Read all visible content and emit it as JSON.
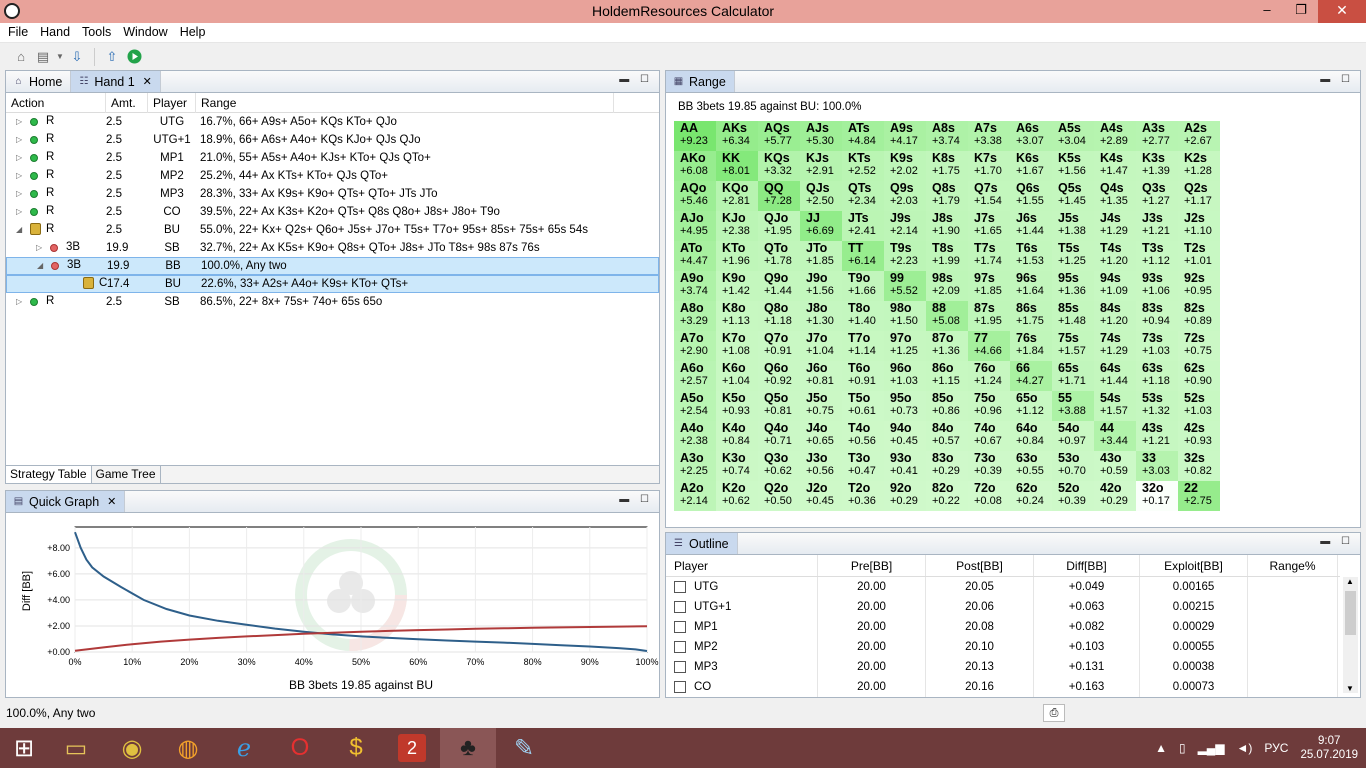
{
  "window": {
    "title": "HoldemResources Calculator",
    "min": "–",
    "max": "❐",
    "close": "✕"
  },
  "menu": [
    "File",
    "Hand",
    "Tools",
    "Window",
    "Help"
  ],
  "tabs": {
    "home": "Home",
    "hand": "Hand 1",
    "range": "Range",
    "quick_graph": "Quick Graph",
    "outline": "Outline"
  },
  "strategy": {
    "headers": {
      "action": "Action",
      "amt": "Amt.",
      "player": "Player",
      "range": "Range"
    },
    "rows": [
      {
        "act": "R",
        "amt": "2.5",
        "player": "UTG",
        "range": "16.7%, 66+ A9s+ A5o+ KQs KTo+ QJo",
        "dot": "g"
      },
      {
        "act": "R",
        "amt": "2.5",
        "player": "UTG+1",
        "range": "18.9%, 66+ A6s+ A4o+ KQs KJo+ QJs QJo",
        "dot": "g"
      },
      {
        "act": "R",
        "amt": "2.5",
        "player": "MP1",
        "range": "21.0%, 55+ A5s+ A4o+ KJs+ KTo+ QJs QTo+",
        "dot": "g"
      },
      {
        "act": "R",
        "amt": "2.5",
        "player": "MP2",
        "range": "25.2%, 44+ Ax KTs+ KTo+ QJs QTo+",
        "dot": "g"
      },
      {
        "act": "R",
        "amt": "2.5",
        "player": "MP3",
        "range": "28.3%, 33+ Ax K9s+ K9o+ QTs+ QTo+ JTs JTo",
        "dot": "g"
      },
      {
        "act": "R",
        "amt": "2.5",
        "player": "CO",
        "range": "39.5%, 22+ Ax K3s+ K2o+ QTs+ Q8s Q8o+ J8s+ J8o+ T9o",
        "dot": "g"
      },
      {
        "act": "R",
        "amt": "2.5",
        "player": "BU",
        "range": "55.0%, 22+ Kx+ Q2s+ Q6o+ J5s+ J7o+ T5s+ T7o+ 95s+ 85s+ 75s+ 65s 54s",
        "dot": "lock"
      },
      {
        "act": "3B",
        "amt": "19.9",
        "player": "SB",
        "range": "32.7%, 22+ Ax K5s+ K9o+ Q8s+ QTo+ J8s+ JTo T8s+ 98s 87s 76s",
        "dot": "r"
      },
      {
        "act": "3B",
        "amt": "19.9",
        "player": "BB",
        "range": "100.0%, Any two",
        "dot": "r"
      },
      {
        "act": "C",
        "amt": "17.4",
        "player": "BU",
        "range": "22.6%, 33+ A2s+ A4o+ K9s+ KTo+ QTs+",
        "dot": "lock"
      },
      {
        "act": "R",
        "amt": "2.5",
        "player": "SB",
        "range": "86.5%, 22+ 8x+ 75s+ 74o+ 65s 65o",
        "dot": "g"
      }
    ],
    "bottom_tabs": [
      "Strategy Table",
      "Game Tree"
    ]
  },
  "range": {
    "caption": "BB 3bets 19.85 against BU: 100.0%",
    "hands": [
      [
        "AA",
        "+9.23"
      ],
      [
        "AKs",
        "+6.34"
      ],
      [
        "AQs",
        "+5.77"
      ],
      [
        "AJs",
        "+5.30"
      ],
      [
        "ATs",
        "+4.84"
      ],
      [
        "A9s",
        "+4.17"
      ],
      [
        "A8s",
        "+3.74"
      ],
      [
        "A7s",
        "+3.38"
      ],
      [
        "A6s",
        "+3.07"
      ],
      [
        "A5s",
        "+3.04"
      ],
      [
        "A4s",
        "+2.89"
      ],
      [
        "A3s",
        "+2.77"
      ],
      [
        "A2s",
        "+2.67"
      ],
      [
        "AKo",
        "+6.08"
      ],
      [
        "KK",
        "+8.01"
      ],
      [
        "KQs",
        "+3.32"
      ],
      [
        "KJs",
        "+2.91"
      ],
      [
        "KTs",
        "+2.52"
      ],
      [
        "K9s",
        "+2.02"
      ],
      [
        "K8s",
        "+1.75"
      ],
      [
        "K7s",
        "+1.70"
      ],
      [
        "K6s",
        "+1.67"
      ],
      [
        "K5s",
        "+1.56"
      ],
      [
        "K4s",
        "+1.47"
      ],
      [
        "K3s",
        "+1.39"
      ],
      [
        "K2s",
        "+1.28"
      ],
      [
        "AQo",
        "+5.46"
      ],
      [
        "KQo",
        "+2.81"
      ],
      [
        "QQ",
        "+7.28"
      ],
      [
        "QJs",
        "+2.50"
      ],
      [
        "QTs",
        "+2.34"
      ],
      [
        "Q9s",
        "+2.03"
      ],
      [
        "Q8s",
        "+1.79"
      ],
      [
        "Q7s",
        "+1.54"
      ],
      [
        "Q6s",
        "+1.55"
      ],
      [
        "Q5s",
        "+1.45"
      ],
      [
        "Q4s",
        "+1.35"
      ],
      [
        "Q3s",
        "+1.27"
      ],
      [
        "Q2s",
        "+1.17"
      ],
      [
        "AJo",
        "+4.95"
      ],
      [
        "KJo",
        "+2.38"
      ],
      [
        "QJo",
        "+1.95"
      ],
      [
        "JJ",
        "+6.69"
      ],
      [
        "JTs",
        "+2.41"
      ],
      [
        "J9s",
        "+2.14"
      ],
      [
        "J8s",
        "+1.90"
      ],
      [
        "J7s",
        "+1.65"
      ],
      [
        "J6s",
        "+1.44"
      ],
      [
        "J5s",
        "+1.38"
      ],
      [
        "J4s",
        "+1.29"
      ],
      [
        "J3s",
        "+1.21"
      ],
      [
        "J2s",
        "+1.10"
      ],
      [
        "ATo",
        "+4.47"
      ],
      [
        "KTo",
        "+1.96"
      ],
      [
        "QTo",
        "+1.78"
      ],
      [
        "JTo",
        "+1.85"
      ],
      [
        "TT",
        "+6.14"
      ],
      [
        "T9s",
        "+2.23"
      ],
      [
        "T8s",
        "+1.99"
      ],
      [
        "T7s",
        "+1.74"
      ],
      [
        "T6s",
        "+1.53"
      ],
      [
        "T5s",
        "+1.25"
      ],
      [
        "T4s",
        "+1.20"
      ],
      [
        "T3s",
        "+1.12"
      ],
      [
        "T2s",
        "+1.01"
      ],
      [
        "A9o",
        "+3.74"
      ],
      [
        "K9o",
        "+1.42"
      ],
      [
        "Q9o",
        "+1.44"
      ],
      [
        "J9o",
        "+1.56"
      ],
      [
        "T9o",
        "+1.66"
      ],
      [
        "99",
        "+5.52"
      ],
      [
        "98s",
        "+2.09"
      ],
      [
        "97s",
        "+1.85"
      ],
      [
        "96s",
        "+1.64"
      ],
      [
        "95s",
        "+1.36"
      ],
      [
        "94s",
        "+1.09"
      ],
      [
        "93s",
        "+1.06"
      ],
      [
        "92s",
        "+0.95"
      ],
      [
        "A8o",
        "+3.29"
      ],
      [
        "K8o",
        "+1.13"
      ],
      [
        "Q8o",
        "+1.18"
      ],
      [
        "J8o",
        "+1.30"
      ],
      [
        "T8o",
        "+1.40"
      ],
      [
        "98o",
        "+1.50"
      ],
      [
        "88",
        "+5.08"
      ],
      [
        "87s",
        "+1.95"
      ],
      [
        "86s",
        "+1.75"
      ],
      [
        "85s",
        "+1.48"
      ],
      [
        "84s",
        "+1.20"
      ],
      [
        "83s",
        "+0.94"
      ],
      [
        "82s",
        "+0.89"
      ],
      [
        "A7o",
        "+2.90"
      ],
      [
        "K7o",
        "+1.08"
      ],
      [
        "Q7o",
        "+0.91"
      ],
      [
        "J7o",
        "+1.04"
      ],
      [
        "T7o",
        "+1.14"
      ],
      [
        "97o",
        "+1.25"
      ],
      [
        "87o",
        "+1.36"
      ],
      [
        "77",
        "+4.66"
      ],
      [
        "76s",
        "+1.84"
      ],
      [
        "75s",
        "+1.57"
      ],
      [
        "74s",
        "+1.29"
      ],
      [
        "73s",
        "+1.03"
      ],
      [
        "72s",
        "+0.75"
      ],
      [
        "A6o",
        "+2.57"
      ],
      [
        "K6o",
        "+1.04"
      ],
      [
        "Q6o",
        "+0.92"
      ],
      [
        "J6o",
        "+0.81"
      ],
      [
        "T6o",
        "+0.91"
      ],
      [
        "96o",
        "+1.03"
      ],
      [
        "86o",
        "+1.15"
      ],
      [
        "76o",
        "+1.24"
      ],
      [
        "66",
        "+4.27"
      ],
      [
        "65s",
        "+1.71"
      ],
      [
        "64s",
        "+1.44"
      ],
      [
        "63s",
        "+1.18"
      ],
      [
        "62s",
        "+0.90"
      ],
      [
        "A5o",
        "+2.54"
      ],
      [
        "K5o",
        "+0.93"
      ],
      [
        "Q5o",
        "+0.81"
      ],
      [
        "J5o",
        "+0.75"
      ],
      [
        "T5o",
        "+0.61"
      ],
      [
        "95o",
        "+0.73"
      ],
      [
        "85o",
        "+0.86"
      ],
      [
        "75o",
        "+0.96"
      ],
      [
        "65o",
        "+1.12"
      ],
      [
        "55",
        "+3.88"
      ],
      [
        "54s",
        "+1.57"
      ],
      [
        "53s",
        "+1.32"
      ],
      [
        "52s",
        "+1.03"
      ],
      [
        "A4o",
        "+2.38"
      ],
      [
        "K4o",
        "+0.84"
      ],
      [
        "Q4o",
        "+0.71"
      ],
      [
        "J4o",
        "+0.65"
      ],
      [
        "T4o",
        "+0.56"
      ],
      [
        "94o",
        "+0.45"
      ],
      [
        "84o",
        "+0.57"
      ],
      [
        "74o",
        "+0.67"
      ],
      [
        "64o",
        "+0.84"
      ],
      [
        "54o",
        "+0.97"
      ],
      [
        "44",
        "+3.44"
      ],
      [
        "43s",
        "+1.21"
      ],
      [
        "42s",
        "+0.93"
      ],
      [
        "A3o",
        "+2.25"
      ],
      [
        "K3o",
        "+0.74"
      ],
      [
        "Q3o",
        "+0.62"
      ],
      [
        "J3o",
        "+0.56"
      ],
      [
        "T3o",
        "+0.47"
      ],
      [
        "93o",
        "+0.41"
      ],
      [
        "83o",
        "+0.29"
      ],
      [
        "73o",
        "+0.39"
      ],
      [
        "63o",
        "+0.55"
      ],
      [
        "53o",
        "+0.70"
      ],
      [
        "43o",
        "+0.59"
      ],
      [
        "33",
        "+3.03"
      ],
      [
        "32s",
        "+0.82"
      ],
      [
        "A2o",
        "+2.14"
      ],
      [
        "K2o",
        "+0.62"
      ],
      [
        "Q2o",
        "+0.50"
      ],
      [
        "J2o",
        "+0.45"
      ],
      [
        "T2o",
        "+0.36"
      ],
      [
        "92o",
        "+0.29"
      ],
      [
        "82o",
        "+0.22"
      ],
      [
        "72o",
        "+0.08"
      ],
      [
        "62o",
        "+0.24"
      ],
      [
        "52o",
        "+0.39"
      ],
      [
        "42o",
        "+0.29"
      ],
      [
        "32o",
        "+0.17"
      ],
      [
        "22",
        "+2.75"
      ]
    ]
  },
  "chart_data": {
    "type": "line",
    "title": "",
    "xlabel": "BB 3bets 19.85 against BU",
    "ylabel": "Diff [BB]",
    "x_ticks": [
      "0%",
      "10%",
      "20%",
      "30%",
      "40%",
      "50%",
      "60%",
      "70%",
      "80%",
      "90%",
      "100%"
    ],
    "y_ticks": [
      "+0.00",
      "+2.00",
      "+4.00",
      "+6.00",
      "+8.00"
    ],
    "xlim": [
      0,
      100
    ],
    "ylim": [
      0,
      9.6
    ],
    "series": [
      {
        "color": "#2e5f8a",
        "x": [
          0,
          1,
          2,
          3,
          5,
          8,
          12,
          16,
          20,
          25,
          30,
          35,
          40,
          45,
          50,
          55,
          60,
          65,
          70,
          75,
          80,
          85,
          90,
          95,
          98,
          100
        ],
        "values": [
          9.2,
          8.0,
          7.1,
          6.5,
          5.8,
          5.0,
          4.0,
          3.3,
          2.8,
          2.4,
          2.1,
          1.8,
          1.55,
          1.35,
          1.2,
          1.08,
          0.98,
          0.88,
          0.8,
          0.72,
          0.62,
          0.52,
          0.42,
          0.3,
          0.2,
          0.08
        ]
      },
      {
        "color": "#b03a3a",
        "x": [
          0,
          5,
          10,
          15,
          20,
          25,
          30,
          35,
          40,
          45,
          50,
          55,
          60,
          65,
          70,
          75,
          80,
          85,
          90,
          95,
          100
        ],
        "values": [
          0.1,
          0.35,
          0.6,
          0.8,
          0.95,
          1.08,
          1.2,
          1.3,
          1.4,
          1.48,
          1.55,
          1.62,
          1.68,
          1.73,
          1.78,
          1.82,
          1.86,
          1.89,
          1.92,
          1.95,
          1.98
        ]
      }
    ]
  },
  "outline": {
    "headers": [
      "Player",
      "Pre[BB]",
      "Post[BB]",
      "Diff[BB]",
      "Exploit[BB]",
      "Range%"
    ],
    "rows": [
      [
        "UTG",
        "20.00",
        "20.05",
        "+0.049",
        "0.00165",
        ""
      ],
      [
        "UTG+1",
        "20.00",
        "20.06",
        "+0.063",
        "0.00215",
        ""
      ],
      [
        "MP1",
        "20.00",
        "20.08",
        "+0.082",
        "0.00029",
        ""
      ],
      [
        "MP2",
        "20.00",
        "20.10",
        "+0.103",
        "0.00055",
        ""
      ],
      [
        "MP3",
        "20.00",
        "20.13",
        "+0.131",
        "0.00038",
        ""
      ],
      [
        "CO",
        "20.00",
        "20.16",
        "+0.163",
        "0.00073",
        ""
      ]
    ]
  },
  "status": "100.0%, Any two",
  "tray": {
    "lang": "РУС",
    "time": "9:07",
    "date": "25.07.2019"
  }
}
